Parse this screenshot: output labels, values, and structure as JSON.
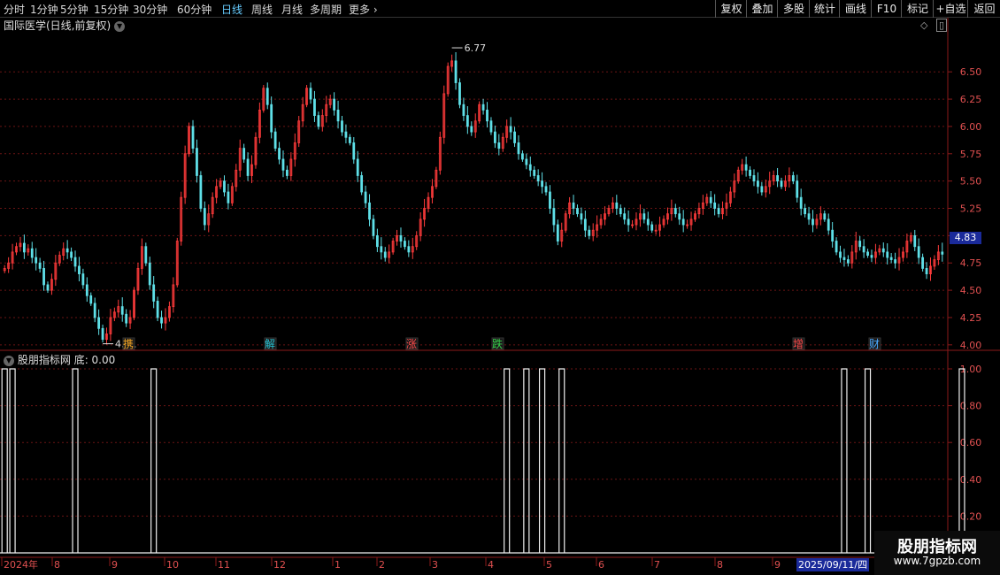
{
  "toolbar": {
    "periods": [
      "分时",
      "1分钟",
      "5分钟",
      "15分钟",
      "30分钟",
      "60分钟",
      "日线",
      "周线",
      "月线",
      "多周期",
      "更多"
    ],
    "active_period": "日线",
    "buttons": [
      "复权",
      "叠加",
      "多股",
      "统计",
      "画线",
      "F10",
      "标记",
      "+自选",
      "返回"
    ]
  },
  "chart_title": "国际医学(日线,前复权)",
  "price_axis": [
    "6.50",
    "6.25",
    "6.00",
    "5.75",
    "5.50",
    "5.25",
    "5.00",
    "4.75",
    "4.50",
    "4.25",
    "4.00"
  ],
  "current_price": "4.83",
  "annotations": {
    "high": "6.77",
    "low": "4.01"
  },
  "event_markers": [
    {
      "label": "携",
      "color": "#f5a623"
    },
    {
      "label": "解",
      "color": "#29c7d8"
    },
    {
      "label": "涨",
      "color": "#ff4a4a"
    },
    {
      "label": "跌",
      "color": "#37d14a"
    },
    {
      "label": "增",
      "color": "#ff4a4a"
    },
    {
      "label": "财",
      "color": "#4aa8ff"
    }
  ],
  "indicator": {
    "name": "股朋指标网",
    "series": "底",
    "value": "0.00",
    "axis": [
      "1.00",
      "0.80",
      "0.60",
      "0.40",
      "0.20"
    ]
  },
  "time_axis": [
    "2024年",
    "8",
    "9",
    "10",
    "11",
    "12",
    "1",
    "2",
    "3",
    "4",
    "5",
    "6",
    "7",
    "8",
    "9"
  ],
  "cursor_date": "2025/09/11/四",
  "watermark": {
    "name": "股朋指标网",
    "url": "www.7gpzb.com"
  },
  "colors": {
    "up": "#ff3b3b",
    "down": "#5fe0e8",
    "frame": "#8b1a1a",
    "active": "#66ccff"
  },
  "chart_data": {
    "type": "candlestick",
    "ylim": [
      3.95,
      6.85
    ],
    "close": [
      4.7,
      4.75,
      4.85,
      4.9,
      4.93,
      4.85,
      4.88,
      4.8,
      4.75,
      4.7,
      4.55,
      4.5,
      4.6,
      4.75,
      4.82,
      4.88,
      4.85,
      4.8,
      4.72,
      4.65,
      4.55,
      4.45,
      4.38,
      4.25,
      4.15,
      4.05,
      4.1,
      4.25,
      4.3,
      4.35,
      4.28,
      4.2,
      4.25,
      4.5,
      4.7,
      4.9,
      4.75,
      4.55,
      4.4,
      4.25,
      4.2,
      4.25,
      4.35,
      4.55,
      4.95,
      5.35,
      5.75,
      6.0,
      5.8,
      5.55,
      5.25,
      5.1,
      5.2,
      5.35,
      5.45,
      5.5,
      5.4,
      5.3,
      5.45,
      5.6,
      5.8,
      5.7,
      5.55,
      5.65,
      5.9,
      6.15,
      6.35,
      6.2,
      5.95,
      5.8,
      5.7,
      5.6,
      5.55,
      5.7,
      5.85,
      6.05,
      6.2,
      6.35,
      6.25,
      6.1,
      6.0,
      6.1,
      6.2,
      6.25,
      6.15,
      6.05,
      5.95,
      5.9,
      5.85,
      5.7,
      5.55,
      5.4,
      5.3,
      5.15,
      5.0,
      4.9,
      4.85,
      4.8,
      4.85,
      4.95,
      5.0,
      4.95,
      4.9,
      4.85,
      4.9,
      5.0,
      5.15,
      5.25,
      5.35,
      5.45,
      5.6,
      5.9,
      6.3,
      6.55,
      6.6,
      6.4,
      6.2,
      6.1,
      6.0,
      5.95,
      6.05,
      6.2,
      6.15,
      6.05,
      5.95,
      5.85,
      5.8,
      5.9,
      6.0,
      5.95,
      5.85,
      5.75,
      5.7,
      5.65,
      5.6,
      5.55,
      5.5,
      5.45,
      5.4,
      5.25,
      5.1,
      4.95,
      5.05,
      5.2,
      5.3,
      5.25,
      5.2,
      5.15,
      5.05,
      5.0,
      5.05,
      5.1,
      5.15,
      5.2,
      5.25,
      5.3,
      5.25,
      5.2,
      5.15,
      5.1,
      5.1,
      5.15,
      5.2,
      5.15,
      5.1,
      5.05,
      5.05,
      5.1,
      5.15,
      5.2,
      5.25,
      5.2,
      5.15,
      5.1,
      5.1,
      5.15,
      5.2,
      5.25,
      5.3,
      5.35,
      5.3,
      5.25,
      5.2,
      5.25,
      5.3,
      5.4,
      5.5,
      5.6,
      5.65,
      5.6,
      5.55,
      5.5,
      5.45,
      5.4,
      5.45,
      5.5,
      5.55,
      5.5,
      5.45,
      5.5,
      5.55,
      5.5,
      5.35,
      5.25,
      5.2,
      5.15,
      5.1,
      5.15,
      5.2,
      5.15,
      5.05,
      4.95,
      4.85,
      4.8,
      4.78,
      4.75,
      4.85,
      4.95,
      4.9,
      4.85,
      4.82,
      4.8,
      4.85,
      4.88,
      4.85,
      4.8,
      4.78,
      4.75,
      4.8,
      4.85,
      4.95,
      5.0,
      4.9,
      4.8,
      4.7,
      4.65,
      4.72,
      4.78,
      4.85,
      4.83
    ],
    "indicator_pulses": [
      {
        "x": 0,
        "h": 1.0
      },
      {
        "x": 2,
        "h": 1.0
      },
      {
        "x": 18,
        "h": 1.0
      },
      {
        "x": 38,
        "h": 1.0
      },
      {
        "x": 128,
        "h": 1.0
      },
      {
        "x": 133,
        "h": 1.0
      },
      {
        "x": 137,
        "h": 1.0
      },
      {
        "x": 142,
        "h": 1.0
      },
      {
        "x": 214,
        "h": 1.0
      },
      {
        "x": 220,
        "h": 1.0
      },
      {
        "x": 244,
        "h": 1.0
      }
    ]
  }
}
